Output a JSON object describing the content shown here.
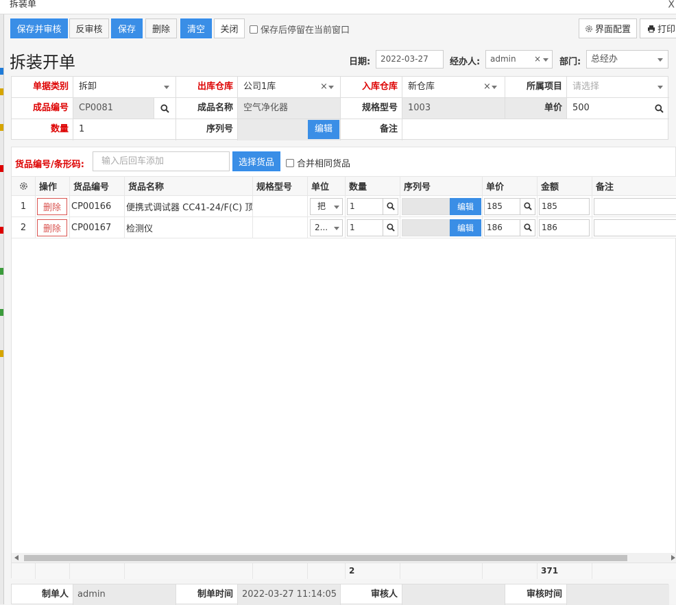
{
  "window": {
    "title": "拆装单",
    "close": "X"
  },
  "toolbar": {
    "save_audit": "保存并审核",
    "unaudit": "反审核",
    "save": "保存",
    "delete": "删除",
    "clear": "清空",
    "close": "关闭",
    "stay_label": "保存后停留在当前窗口",
    "ui_config": "界面配置",
    "print": "打印"
  },
  "header": {
    "title": "拆装开单",
    "date_label": "日期:",
    "date_value": "2022-03-27",
    "handler_label": "经办人:",
    "handler_value": "admin",
    "dept_label": "部门:",
    "dept_value": "总经办"
  },
  "form": {
    "doc_type_label": "单据类别",
    "doc_type_value": "拆卸",
    "out_wh_label": "出库仓库",
    "out_wh_value": "公司1库",
    "in_wh_label": "入库仓库",
    "in_wh_value": "新仓库",
    "project_label": "所属项目",
    "project_placeholder": "请选择",
    "product_code_label": "成品编号",
    "product_code_value": "CP0081",
    "product_name_label": "成品名称",
    "product_name_value": "空气净化器",
    "spec_label": "规格型号",
    "spec_value": "1003",
    "price_label": "单价",
    "price_value": "500",
    "qty_label": "数量",
    "qty_value": "1",
    "serial_label": "序列号",
    "serial_edit": "编辑",
    "remark_label": "备注",
    "remark_value": ""
  },
  "grid": {
    "search_label": "货品编号/条形码:",
    "search_placeholder": "输入后回车添加",
    "select_button": "选择货品",
    "merge_label": "合并相同货品",
    "columns": [
      "操作",
      "货品编号",
      "货品名称",
      "规格型号",
      "单位",
      "数量",
      "序列号",
      "单价",
      "金额",
      "备注"
    ],
    "rows": [
      {
        "idx": "1",
        "op": "删除",
        "code": "CP00166",
        "name": "便携式调试器 CC41-24/F(C) 顶",
        "spec": "",
        "unit": "把",
        "qty": "1",
        "serial_edit": "编辑",
        "price": "185",
        "amount": "185",
        "remark": ""
      },
      {
        "idx": "2",
        "op": "删除",
        "code": "CP00167",
        "name": "检测仪",
        "spec": "",
        "unit": "2...",
        "qty": "1",
        "serial_edit": "编辑",
        "price": "186",
        "amount": "186",
        "remark": ""
      }
    ],
    "sum_qty": "2",
    "sum_amount": "371"
  },
  "footer": {
    "creator_label": "制单人",
    "creator_value": "admin",
    "created_label": "制单时间",
    "created_value": "2022-03-27 11:14:05",
    "auditor_label": "审核人",
    "auditor_value": "",
    "audit_time_label": "审核时间",
    "audit_time_value": ""
  },
  "colors": {
    "primary": "#3a8ee6",
    "required": "#dd0000",
    "delete": "#d9534f"
  }
}
